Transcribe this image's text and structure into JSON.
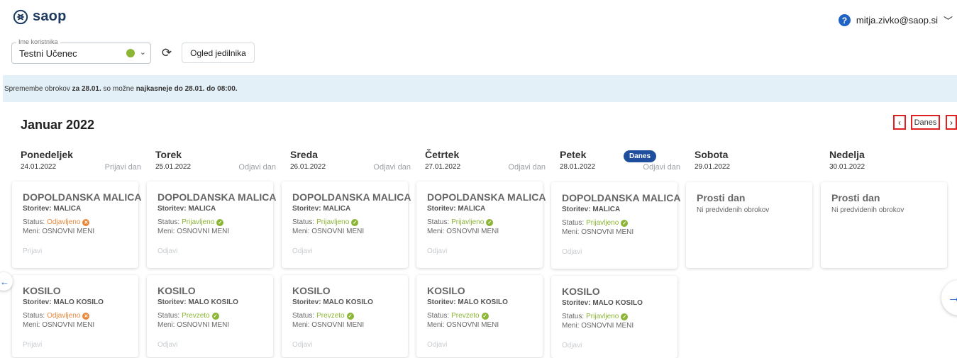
{
  "app": {
    "logo_text": "saop",
    "brand_color": "#1e3a5f"
  },
  "header": {
    "user_email": "mitja.zivko@saop.si",
    "help_icon": "?"
  },
  "controls": {
    "user_label": "Ime koristnika",
    "user_value": "Testni Učenec",
    "menu_button": "Ogled jedilnika"
  },
  "banner": {
    "text1": "Spremembe obrokov ",
    "text2": "za 28.01.",
    "text3": " so možne ",
    "text4": "najkasneje do 28.01. do 08:00."
  },
  "calendar": {
    "month": "Januar 2022",
    "prev": "‹",
    "today_button": "Danes",
    "next": "›",
    "today_badge": "Danes",
    "days": [
      {
        "name": "Ponedeljek",
        "date": "24.01.2022",
        "action": "Prijavi dan"
      },
      {
        "name": "Torek",
        "date": "25.01.2022",
        "action": "Odjavi dan"
      },
      {
        "name": "Sreda",
        "date": "26.01.2022",
        "action": "Odjavi dan"
      },
      {
        "name": "Četrtek",
        "date": "27.01.2022",
        "action": "Odjavi dan"
      },
      {
        "name": "Petek",
        "date": "28.01.2022",
        "action": "Odjavi dan"
      },
      {
        "name": "Sobota",
        "date": "29.01.2022",
        "action": ""
      },
      {
        "name": "Nedelja",
        "date": "30.01.2022",
        "action": ""
      }
    ],
    "breakfast": [
      {
        "title": "DOPOLDANSKA MALICA",
        "service": "Storitev: MALICA",
        "status_label": "Status: ",
        "status": "Odjavljeno",
        "menu": "Meni: OSNOVNI MENI",
        "action": "Prijavi"
      },
      {
        "title": "DOPOLDANSKA MALICA",
        "service": "Storitev: MALICA",
        "status_label": "Status: ",
        "status": "Prijavljeno",
        "menu": "Meni: OSNOVNI MENI",
        "action": "Odjavi"
      },
      {
        "title": "DOPOLDANSKA MALICA",
        "service": "Storitev: MALICA",
        "status_label": "Status: ",
        "status": "Prijavljeno",
        "menu": "Meni: OSNOVNI MENI",
        "action": "Odjavi"
      },
      {
        "title": "DOPOLDANSKA MALICA",
        "service": "Storitev: MALICA",
        "status_label": "Status: ",
        "status": "Prijavljeno",
        "menu": "Meni: OSNOVNI MENI",
        "action": "Odjavi"
      },
      {
        "title": "DOPOLDANSKA MALICA",
        "service": "Storitev: MALICA",
        "status_label": "Status: ",
        "status": "Prijavljeno",
        "menu": "Meni: OSNOVNI MENI",
        "action": "Odjavi"
      }
    ],
    "lunch": [
      {
        "title": "KOSILO",
        "service": "Storitev: MALO KOSILO",
        "status_label": "Status: ",
        "status": "Odjavljeno",
        "menu": "Meni: OSNOVNI MENI",
        "action": "Prijavi"
      },
      {
        "title": "KOSILO",
        "service": "Storitev: MALO KOSILO",
        "status_label": "Status: ",
        "status": "Prevzeto",
        "menu": "Meni: OSNOVNI MENI",
        "action": "Odjavi"
      },
      {
        "title": "KOSILO",
        "service": "Storitev: MALO KOSILO",
        "status_label": "Status: ",
        "status": "Prevzeto",
        "menu": "Meni: OSNOVNI MENI",
        "action": "Odjavi"
      },
      {
        "title": "KOSILO",
        "service": "Storitev: MALO KOSILO",
        "status_label": "Status: ",
        "status": "Prevzeto",
        "menu": "Meni: OSNOVNI MENI",
        "action": "Odjavi"
      },
      {
        "title": "KOSILO",
        "service": "Storitev: MALO KOSILO",
        "status_label": "Status: ",
        "status": "Prijavljeno",
        "menu": "Meni: OSNOVNI MENI",
        "action": "Odjavi"
      }
    ],
    "free_day": {
      "title": "Prosti dan",
      "subtitle": "Ni predvidenih obrokov"
    }
  },
  "colors": {
    "accent": "#1f63c6",
    "ok": "#8bb534",
    "off": "#e8873a",
    "banner": "#e4f0f7",
    "highlight": "#e02020"
  }
}
